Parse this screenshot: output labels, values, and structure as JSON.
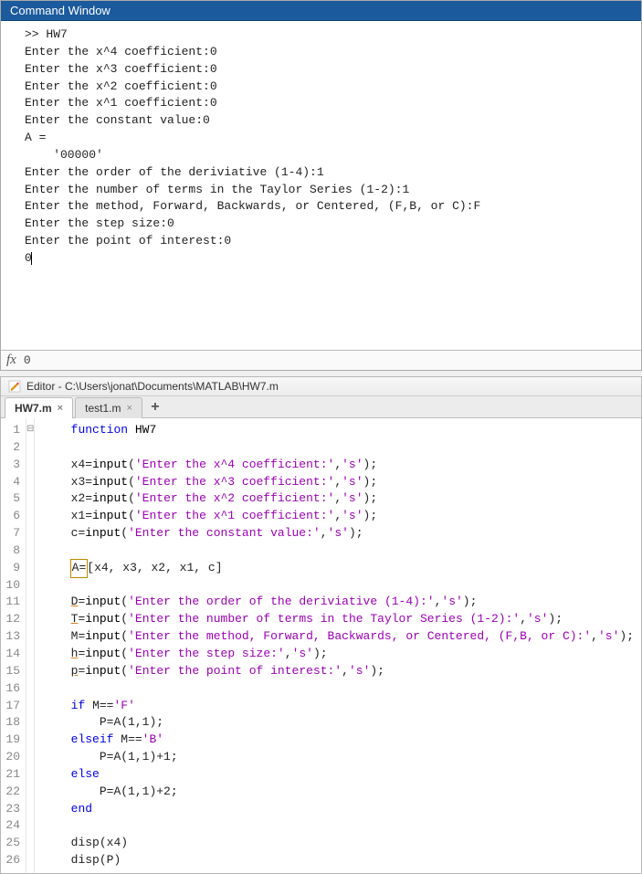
{
  "command_window": {
    "title": "Command Window",
    "lines": [
      ">> HW7",
      "Enter the x^4 coefficient:0",
      "Enter the x^3 coefficient:0",
      "Enter the x^2 coefficient:0",
      "Enter the x^1 coefficient:0",
      "Enter the constant value:0",
      "",
      "A =",
      "",
      "    '00000'",
      "",
      "Enter the order of the deriviative (1-4):1",
      "Enter the number of terms in the Taylor Series (1-2):1",
      "Enter the method, Forward, Backwards, or Centered, (F,B, or C):F",
      "Enter the step size:0",
      "Enter the point of interest:0",
      "0"
    ],
    "fx_value": "0"
  },
  "editor": {
    "icon": "pencil-icon",
    "title_prefix": "Editor - ",
    "file_path": "C:\\Users\\jonat\\Documents\\MATLAB\\HW7.m",
    "tabs": [
      {
        "label": "HW7.m",
        "active": true
      },
      {
        "label": "test1.m",
        "active": false
      }
    ],
    "add_tab_label": "+",
    "code_lines": [
      {
        "n": 1,
        "tokens": [
          [
            "    ",
            ""
          ],
          [
            "function ",
            "kw"
          ],
          [
            "HW7",
            "var"
          ]
        ]
      },
      {
        "n": 2,
        "tokens": [
          [
            "",
            ""
          ]
        ]
      },
      {
        "n": 3,
        "tokens": [
          [
            "    x4=",
            ""
          ],
          [
            "input",
            "var"
          ],
          [
            "(",
            ""
          ],
          [
            "'Enter the x^4 coefficient:'",
            "str"
          ],
          [
            ",",
            ""
          ],
          [
            "'s'",
            "str"
          ],
          [
            ");",
            ""
          ]
        ]
      },
      {
        "n": 4,
        "tokens": [
          [
            "    x3=",
            ""
          ],
          [
            "input",
            "var"
          ],
          [
            "(",
            ""
          ],
          [
            "'Enter the x^3 coefficient:'",
            "str"
          ],
          [
            ",",
            ""
          ],
          [
            "'s'",
            "str"
          ],
          [
            ");",
            ""
          ]
        ]
      },
      {
        "n": 5,
        "tokens": [
          [
            "    x2=",
            ""
          ],
          [
            "input",
            "var"
          ],
          [
            "(",
            ""
          ],
          [
            "'Enter the x^2 coefficient:'",
            "str"
          ],
          [
            ",",
            ""
          ],
          [
            "'s'",
            "str"
          ],
          [
            ");",
            ""
          ]
        ]
      },
      {
        "n": 6,
        "tokens": [
          [
            "    x1=",
            ""
          ],
          [
            "input",
            "var"
          ],
          [
            "(",
            ""
          ],
          [
            "'Enter the x^1 coefficient:'",
            "str"
          ],
          [
            ",",
            ""
          ],
          [
            "'s'",
            "str"
          ],
          [
            ");",
            ""
          ]
        ]
      },
      {
        "n": 7,
        "tokens": [
          [
            "    c=",
            ""
          ],
          [
            "input",
            "var"
          ],
          [
            "(",
            ""
          ],
          [
            "'Enter the constant value:'",
            "str"
          ],
          [
            ",",
            ""
          ],
          [
            "'s'",
            "str"
          ],
          [
            ");",
            ""
          ]
        ]
      },
      {
        "n": 8,
        "tokens": [
          [
            "",
            ""
          ]
        ]
      },
      {
        "n": 9,
        "tokens": [
          [
            "    ",
            ""
          ],
          [
            "A=",
            "cursor-box"
          ],
          [
            "[x4, x3, x2, x1, c]",
            ""
          ]
        ]
      },
      {
        "n": 10,
        "tokens": [
          [
            "",
            ""
          ]
        ]
      },
      {
        "n": 11,
        "tokens": [
          [
            "    ",
            ""
          ],
          [
            "D",
            "underline-var"
          ],
          [
            "=",
            ""
          ],
          [
            "input",
            "var"
          ],
          [
            "(",
            ""
          ],
          [
            "'Enter the order of the deriviative (1-4):'",
            "str"
          ],
          [
            ",",
            ""
          ],
          [
            "'s'",
            "str"
          ],
          [
            ");",
            ""
          ]
        ]
      },
      {
        "n": 12,
        "tokens": [
          [
            "    ",
            ""
          ],
          [
            "T",
            "underline-var"
          ],
          [
            "=",
            ""
          ],
          [
            "input",
            "var"
          ],
          [
            "(",
            ""
          ],
          [
            "'Enter the number of terms in the Taylor Series (1-2):'",
            "str"
          ],
          [
            ",",
            ""
          ],
          [
            "'s'",
            "str"
          ],
          [
            ");",
            ""
          ]
        ]
      },
      {
        "n": 13,
        "tokens": [
          [
            "    M=",
            ""
          ],
          [
            "input",
            "var"
          ],
          [
            "(",
            ""
          ],
          [
            "'Enter the method, Forward, Backwards, or Centered, (F,B, or C):'",
            "str"
          ],
          [
            ",",
            ""
          ],
          [
            "'s'",
            "str"
          ],
          [
            ");",
            ""
          ]
        ]
      },
      {
        "n": 14,
        "tokens": [
          [
            "    ",
            ""
          ],
          [
            "h",
            "underline-var"
          ],
          [
            "=",
            ""
          ],
          [
            "input",
            "var"
          ],
          [
            "(",
            ""
          ],
          [
            "'Enter the step size:'",
            "str"
          ],
          [
            ",",
            ""
          ],
          [
            "'s'",
            "str"
          ],
          [
            ");",
            ""
          ]
        ]
      },
      {
        "n": 15,
        "tokens": [
          [
            "    ",
            ""
          ],
          [
            "p",
            "underline-var"
          ],
          [
            "=",
            ""
          ],
          [
            "input",
            "var"
          ],
          [
            "(",
            ""
          ],
          [
            "'Enter the point of interest:'",
            "str"
          ],
          [
            ",",
            ""
          ],
          [
            "'s'",
            "str"
          ],
          [
            ");",
            ""
          ]
        ]
      },
      {
        "n": 16,
        "tokens": [
          [
            "",
            ""
          ]
        ]
      },
      {
        "n": 17,
        "tokens": [
          [
            "    ",
            ""
          ],
          [
            "if ",
            "kw"
          ],
          [
            "M==",
            ""
          ],
          [
            "'F'",
            "str"
          ]
        ]
      },
      {
        "n": 18,
        "tokens": [
          [
            "        P=A(1,1);",
            ""
          ]
        ]
      },
      {
        "n": 19,
        "tokens": [
          [
            "    ",
            ""
          ],
          [
            "elseif ",
            "kw"
          ],
          [
            "M==",
            ""
          ],
          [
            "'B'",
            "str"
          ]
        ]
      },
      {
        "n": 20,
        "tokens": [
          [
            "        P=A(1,1)+1;",
            ""
          ]
        ]
      },
      {
        "n": 21,
        "tokens": [
          [
            "    ",
            ""
          ],
          [
            "else",
            "kw"
          ]
        ]
      },
      {
        "n": 22,
        "tokens": [
          [
            "        P=A(1,1)+2;",
            ""
          ]
        ]
      },
      {
        "n": 23,
        "tokens": [
          [
            "    ",
            ""
          ],
          [
            "end",
            "kw"
          ]
        ]
      },
      {
        "n": 24,
        "tokens": [
          [
            "",
            ""
          ]
        ]
      },
      {
        "n": 25,
        "tokens": [
          [
            "    disp(x4)",
            ""
          ]
        ]
      },
      {
        "n": 26,
        "tokens": [
          [
            "    disp(P)",
            ""
          ]
        ]
      }
    ],
    "fold_marks": {
      "1": "⊟"
    }
  }
}
